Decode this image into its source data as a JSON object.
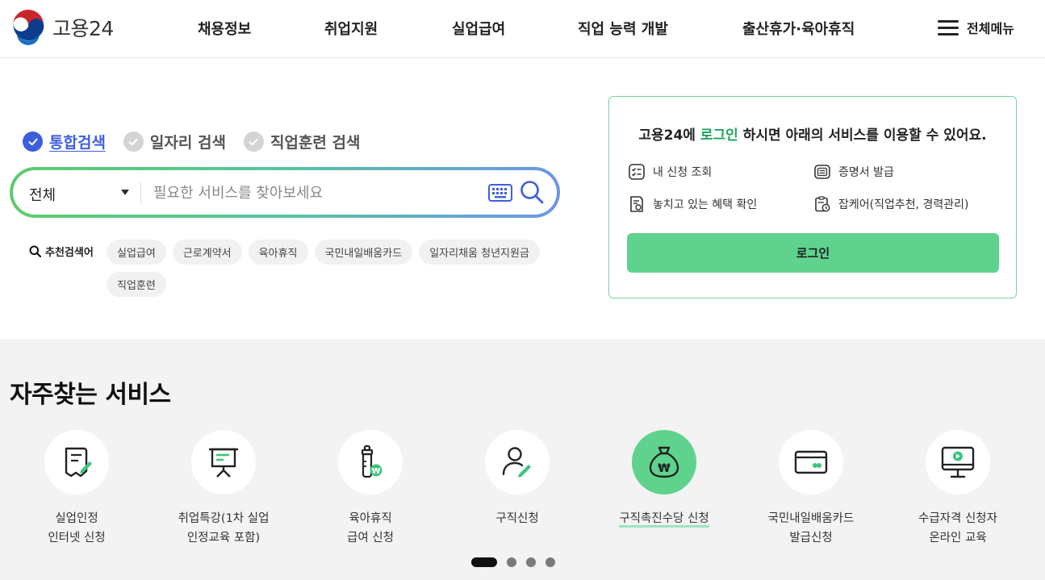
{
  "header": {
    "logo_text": "고용24",
    "nav": [
      "채용정보",
      "취업지원",
      "실업급여",
      "직업 능력 개발",
      "출산휴가·육아휴직"
    ],
    "all_menu_label": "전체메뉴"
  },
  "search": {
    "tabs": [
      {
        "label": "통합검색",
        "active": true
      },
      {
        "label": "일자리 검색",
        "active": false
      },
      {
        "label": "직업훈련 검색",
        "active": false
      }
    ],
    "scope_value": "전체",
    "placeholder": "필요한 서비스를 찾아보세요",
    "recommend_label": "추천검색어",
    "keywords": [
      "실업급여",
      "근로계약서",
      "육아휴직",
      "국민내일배움카드",
      "일자리채움 청년지원금",
      "직업훈련"
    ]
  },
  "login": {
    "title_prefix": "고용24에 ",
    "title_highlight": "로그인",
    "title_suffix": " 하시면 아래의 서비스를 이용할 수 있어요.",
    "services": [
      "내 신청 조회",
      "증명서 발급",
      "놓치고 있는 혜택 확인",
      "잡케어(직업추천, 경력관리)"
    ],
    "button_label": "로그인"
  },
  "frequent": {
    "title": "자주찾는 서비스",
    "items": [
      {
        "label": "실업인정\n인터넷 신청",
        "icon": "document-pen-icon"
      },
      {
        "label": "취업특강(1차 실업\n인정교육 포함)",
        "icon": "presentation-board-icon"
      },
      {
        "label": "육아휴직\n급여 신청",
        "icon": "baby-bottle-won-icon"
      },
      {
        "label": "구직신청",
        "icon": "person-pen-icon"
      },
      {
        "label": "구직촉진수당 신청",
        "icon": "money-bag-icon",
        "active": true
      },
      {
        "label": "국민내일배움카드\n발급신청",
        "icon": "card-icon"
      },
      {
        "label": "수급자격 신청자\n온라인 교육",
        "icon": "monitor-play-icon"
      }
    ],
    "pager": {
      "pages": 4,
      "current": 1
    }
  },
  "colors": {
    "accent_blue": "#3e5fdc",
    "accent_green": "#5fd38e",
    "highlight_green": "#1fa45a"
  }
}
